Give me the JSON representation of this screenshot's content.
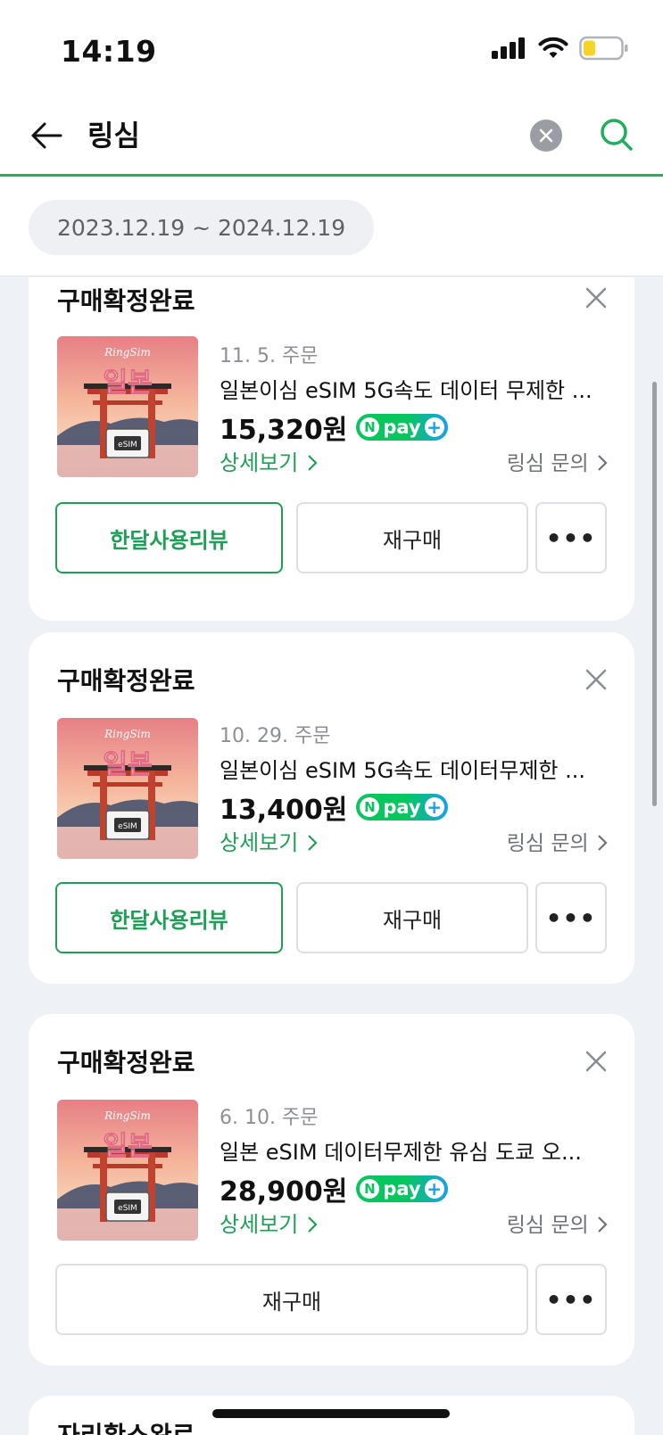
{
  "status_bar": {
    "time": "14:19",
    "battery_color": "#f5d327"
  },
  "header": {
    "query": "링심"
  },
  "filter": {
    "date_range": "2023.12.19 ~ 2024.12.19"
  },
  "thumbnail": {
    "brand": "RingSim",
    "headline": "일본",
    "card_label": "eSIM"
  },
  "orders": [
    {
      "status": "구매확정완료",
      "order_date": "11. 5. 주문",
      "product_name": "일본이심 eSIM 5G속도 데이터 무제한 ...",
      "price": "15,320원",
      "detail_label": "상세보기",
      "inquiry_label": "링심 문의",
      "review_label": "한달사용리뷰",
      "rebuy_label": "재구매",
      "more_label": "•••"
    },
    {
      "status": "구매확정완료",
      "order_date": "10. 29. 주문",
      "product_name": "일본이심 eSIM 5G속도 데이터무제한 ...",
      "price": "13,400원",
      "detail_label": "상세보기",
      "inquiry_label": "링심 문의",
      "review_label": "한달사용리뷰",
      "rebuy_label": "재구매",
      "more_label": "•••"
    },
    {
      "status": "구매확정완료",
      "order_date": "6. 10. 주문",
      "product_name": "일본 eSIM 데이터무제한 유심 도쿄 오...",
      "price": "28,900원",
      "detail_label": "상세보기",
      "inquiry_label": "링심 문의",
      "rebuy_label": "재구매",
      "more_label": "•••"
    }
  ],
  "npay": {
    "n": "N",
    "text": "pay",
    "plus": "+"
  },
  "peek": {
    "status": "자리확소완료"
  },
  "colors": {
    "accent": "#27ae5e",
    "link": "#1f9e55"
  }
}
